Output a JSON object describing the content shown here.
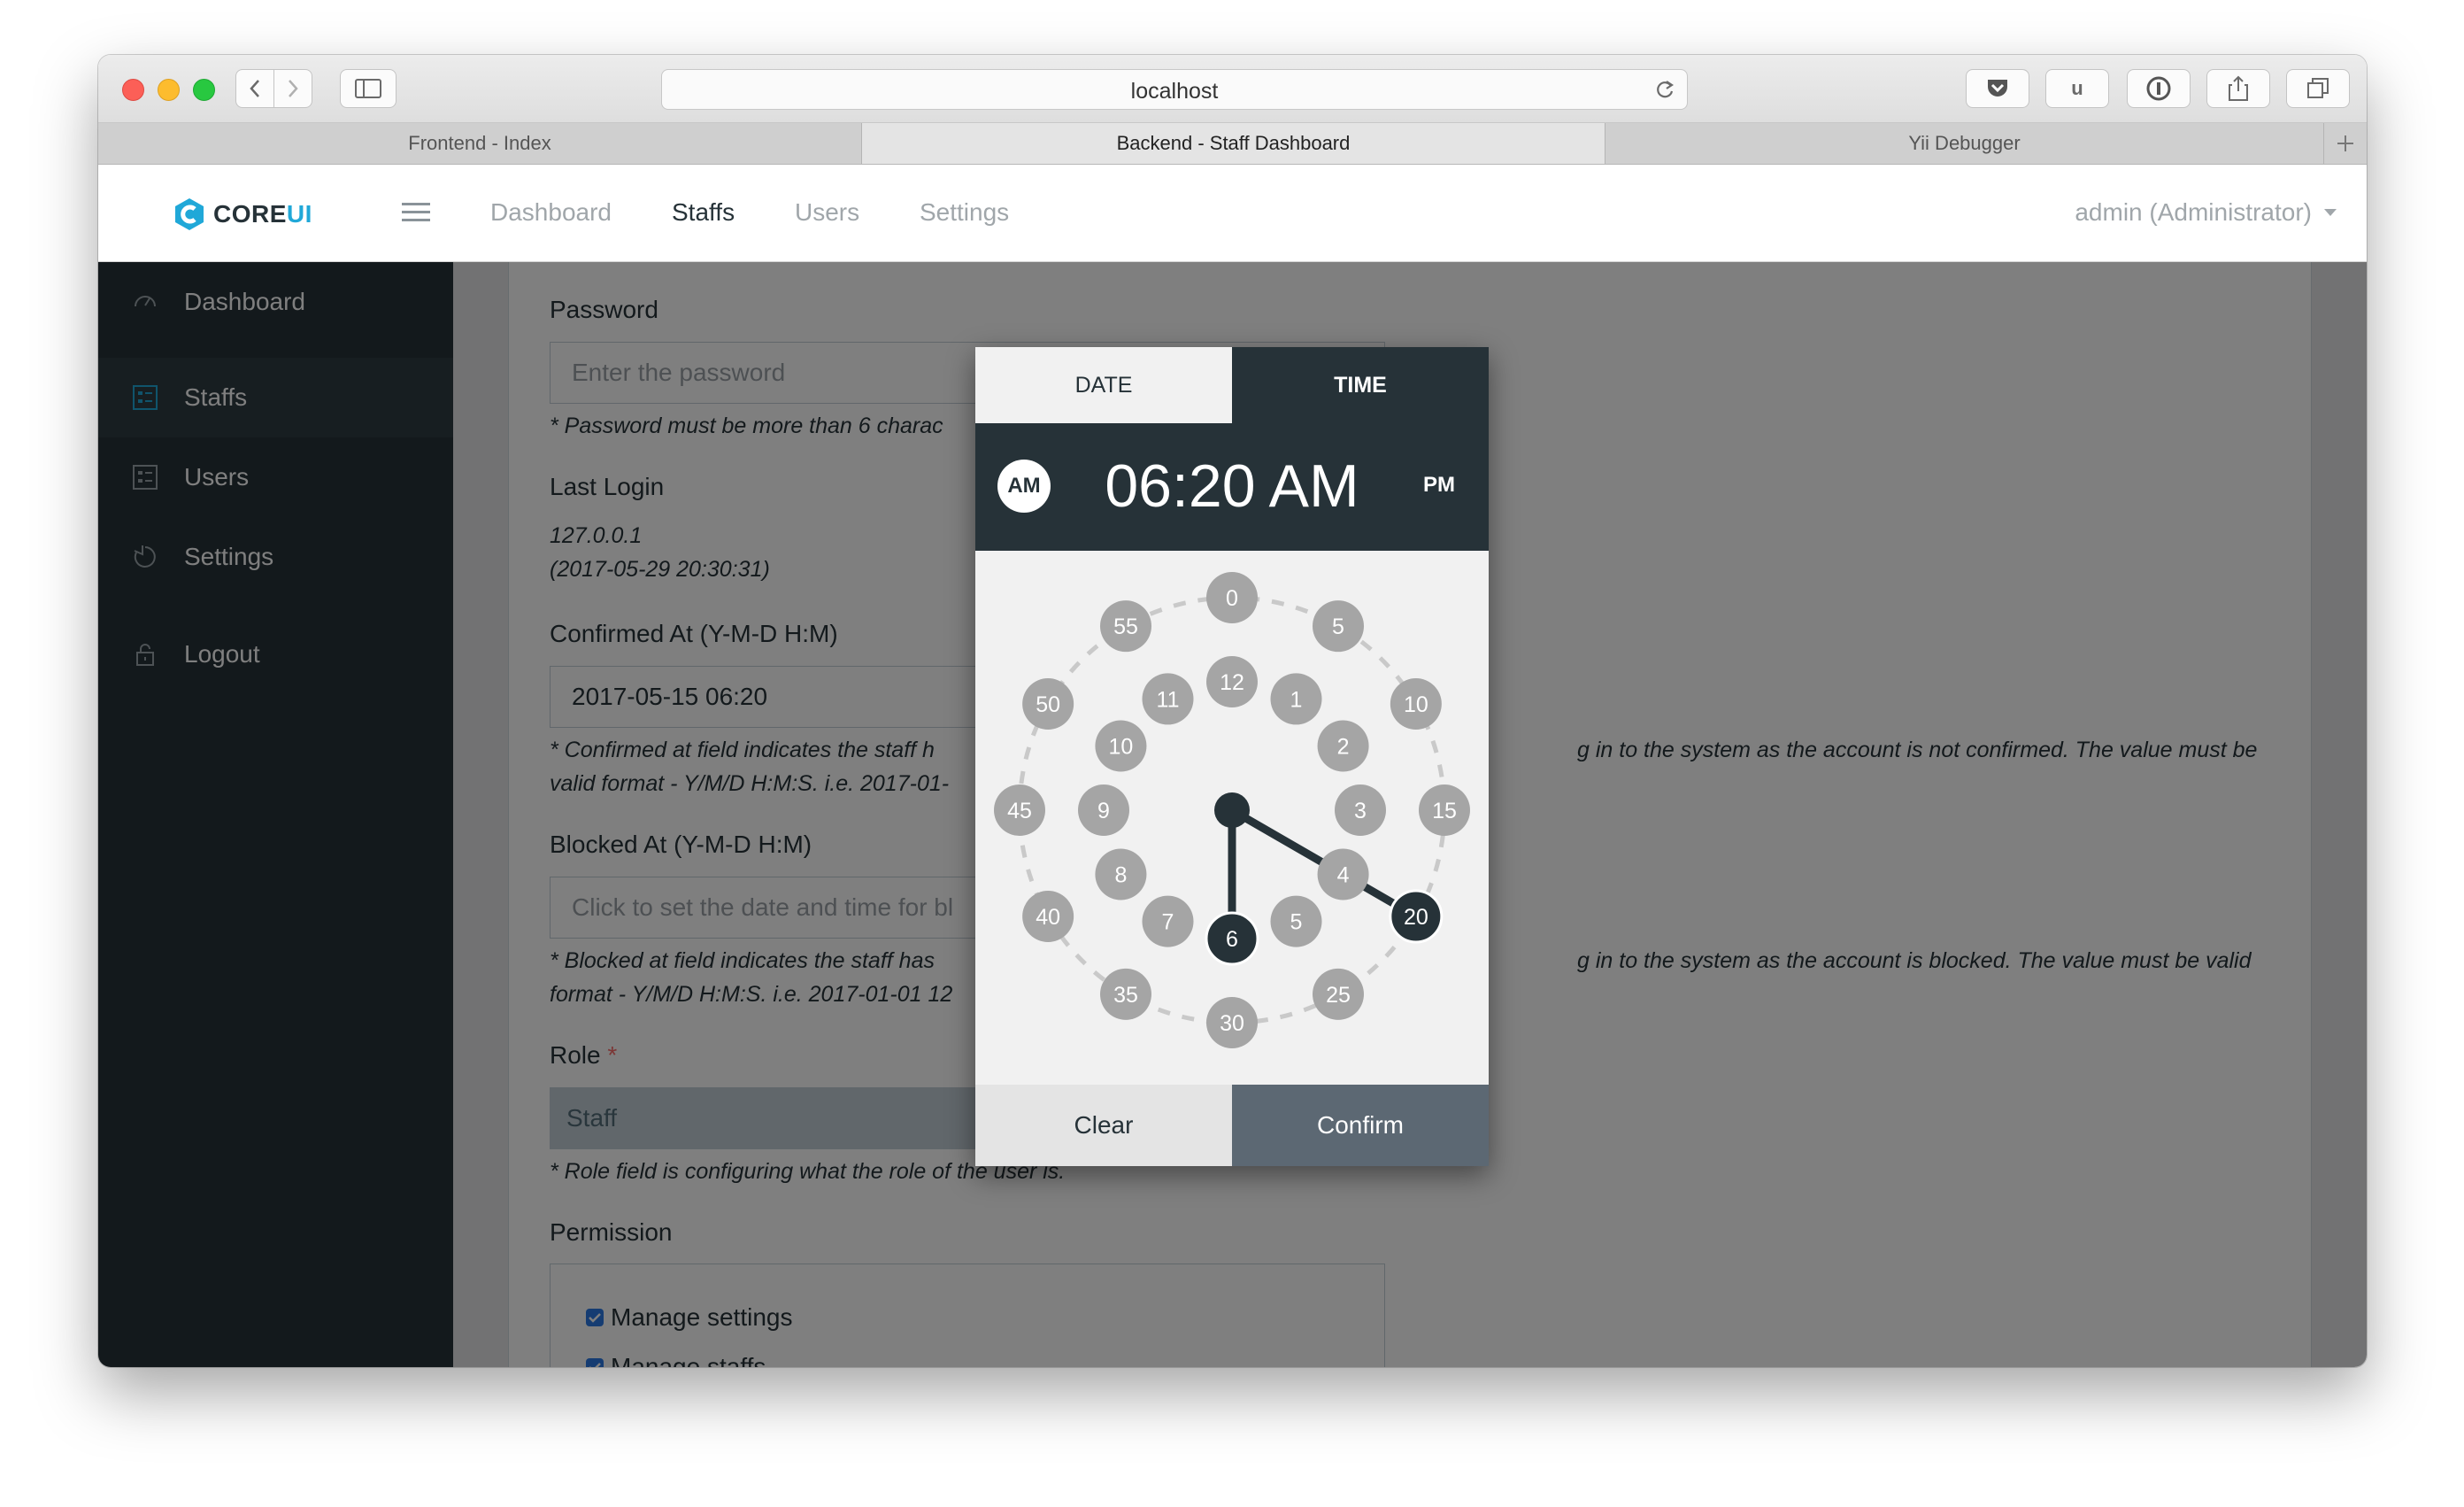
{
  "browser": {
    "url": "localhost",
    "tabs": [
      "Frontend - Index",
      "Backend - Staff Dashboard",
      "Yii Debugger"
    ],
    "toolbar_u": "u"
  },
  "header": {
    "logo_core": "CORE",
    "logo_ui": "UI",
    "nav": [
      "Dashboard",
      "Staffs",
      "Users",
      "Settings"
    ],
    "user": "admin (Administrator)"
  },
  "sidebar": {
    "items": [
      {
        "label": "Dashboard",
        "icon": "speedometer-icon"
      },
      {
        "label": "Staffs",
        "icon": "grid-list-icon"
      },
      {
        "label": "Users",
        "icon": "grid-list-icon"
      },
      {
        "label": "Settings",
        "icon": "pie-chart-icon"
      },
      {
        "label": "Logout",
        "icon": "lock-icon"
      }
    ]
  },
  "form": {
    "password_label": "Password",
    "password_placeholder": "Enter the password",
    "password_help": "* Password must be more than 6 charac",
    "last_login_label": "Last Login",
    "last_login_ip": "127.0.0.1",
    "last_login_time": "(2017-05-29 20:30:31)",
    "confirmed_label": "Confirmed At (Y-M-D H:M)",
    "confirmed_value": "2017-05-15 06:20",
    "confirmed_help_1a": "* Confirmed at field indicates the staff h",
    "confirmed_help_1b": "g in to the system as the account is not confirmed. The value must be",
    "confirmed_help_2": "valid format - Y/M/D H:M:S. i.e. 2017-01-",
    "blocked_label": "Blocked At (Y-M-D H:M)",
    "blocked_placeholder": "Click to set the date and time for bl",
    "blocked_help_1a": "* Blocked at field indicates the staff has",
    "blocked_help_1b": "g in to the system as the account is blocked. The value must be valid",
    "blocked_help_2": "format - Y/M/D H:M:S. i.e. 2017-01-01 12",
    "role_label": "Role",
    "role_required": "*",
    "role_value": "Staff",
    "role_help": "* Role field is configuring what the role of the user is.",
    "permission_label": "Permission",
    "permissions": [
      "Manage settings",
      "Manage staffs"
    ]
  },
  "picker": {
    "tab_date": "DATE",
    "tab_time": "TIME",
    "am": "AM",
    "pm": "PM",
    "time": "06:20 AM",
    "selected_hour": "6",
    "selected_minute": "20",
    "minutes": [
      "0",
      "5",
      "10",
      "15",
      "20",
      "25",
      "30",
      "35",
      "40",
      "45",
      "50",
      "55"
    ],
    "hours": [
      "12",
      "1",
      "2",
      "3",
      "4",
      "5",
      "6",
      "7",
      "8",
      "9",
      "10",
      "11"
    ],
    "clear": "Clear",
    "confirm": "Confirm",
    "colors": {
      "dark": "#263238",
      "bubble": "#a5a5a5",
      "confirm_bg": "#5c6873"
    }
  }
}
